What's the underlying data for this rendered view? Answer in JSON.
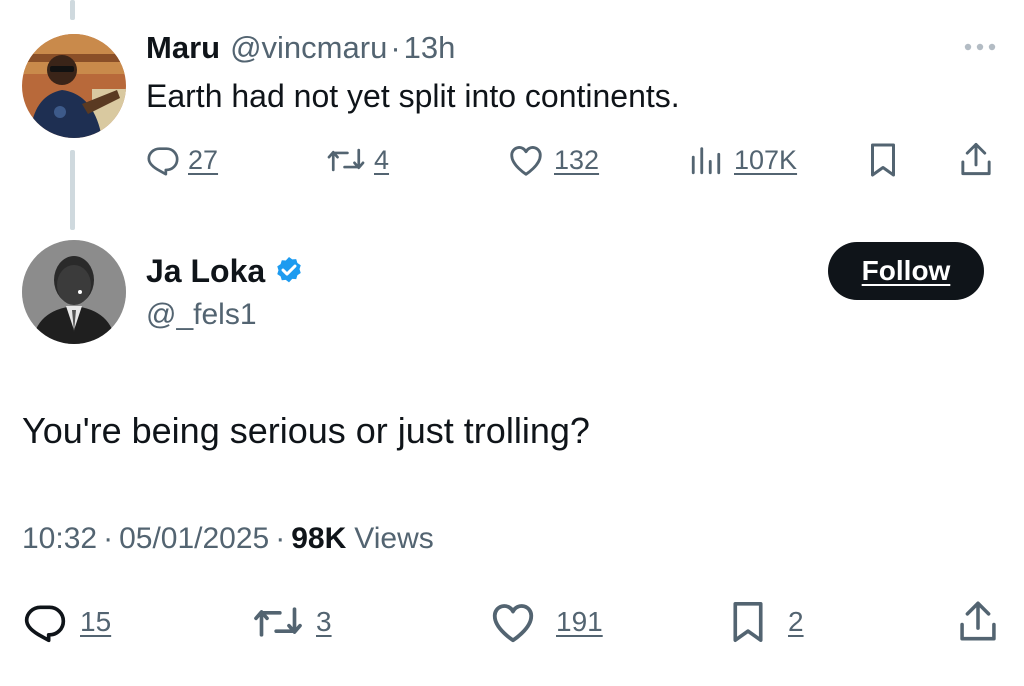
{
  "colors": {
    "text": "#0f1419",
    "muted": "#536471",
    "verified": "#1d9bf0",
    "thread_line": "#cfd9de",
    "button_bg": "#0f1419"
  },
  "parent_tweet": {
    "display_name": "Maru",
    "handle": "@vincmaru",
    "separator": "·",
    "time": "13h",
    "text": "Earth had not yet split into continents.",
    "more_icon": "more-icon",
    "actions": {
      "replies": "27",
      "retweets": "4",
      "likes": "132",
      "views": "107K"
    }
  },
  "main_tweet": {
    "display_name": "Ja Loka",
    "handle": "@_fels1",
    "verified": true,
    "follow_label": "Follow",
    "text": "You're being serious or just trolling?",
    "meta": {
      "time": "10:32",
      "separator": "·",
      "date": "05/01/2025",
      "views_count": "98K",
      "views_label": "Views"
    },
    "actions": {
      "replies": "15",
      "retweets": "3",
      "likes": "191",
      "bookmarks": "2"
    }
  }
}
